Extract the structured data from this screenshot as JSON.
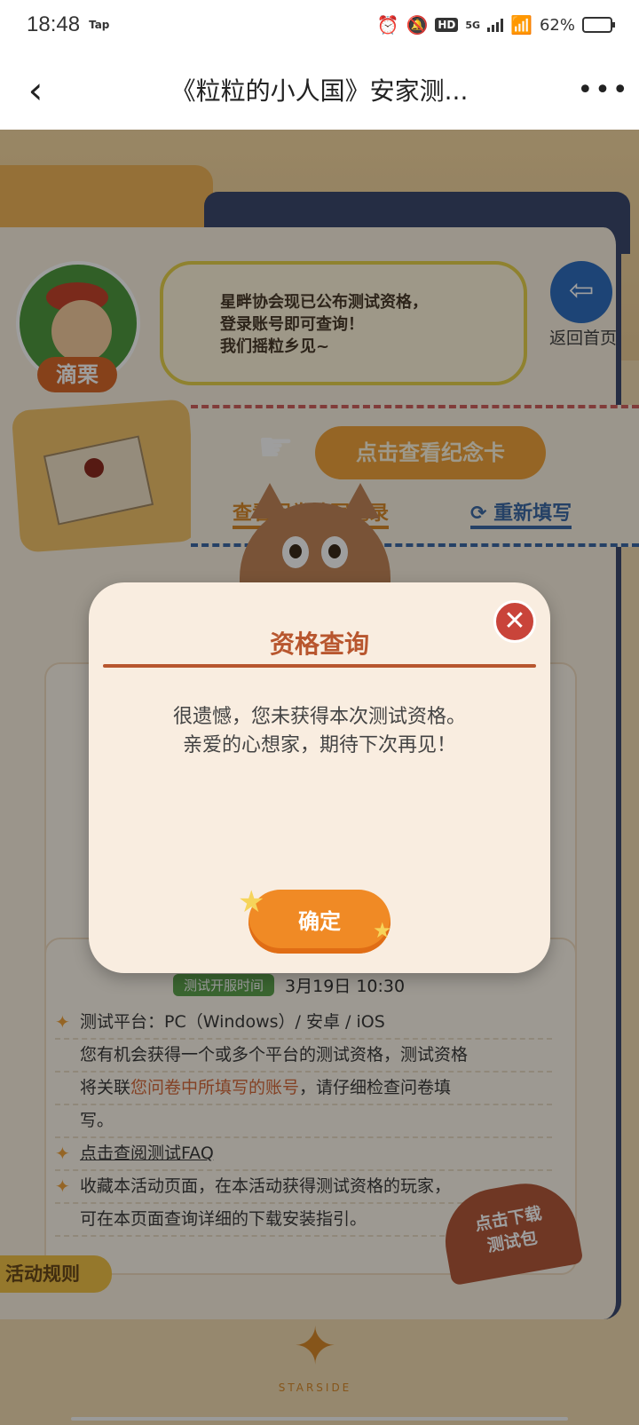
{
  "status_bar": {
    "time": "18:48",
    "tap_label": "Tap",
    "battery_text": "62%",
    "battery_level": 0.62,
    "network": "5G",
    "hd": "HD"
  },
  "nav": {
    "title": "《粒粒的小人国》安家测...",
    "back_icon": "chevron-left",
    "more_icon": "more-dots"
  },
  "page": {
    "avatar_name": "滴栗",
    "bubble_lines": [
      "星畔协会现已公布测试资格，",
      "登录账号即可查询！",
      "我们摇粒乡见~"
    ],
    "home_label": "返回首页",
    "memorial_button": "点击查看纪念卡",
    "record_link": "查看问卷填写记录",
    "refill_link": "重新填写",
    "server_time_tag": "测试开服时间",
    "server_time_value": "3月19日 10:30",
    "rules": {
      "platform": "测试平台：PC（Windows）/ 安卓 / iOS",
      "desc_1": "您有机会获得一个或多个平台的测试资格，测试资格",
      "desc_2a": "将关联",
      "desc_2_highlight": "您问卷中所填写的账号",
      "desc_2b": "，请仔细检查问卷填",
      "desc_3": "写。",
      "faq_link": "点击查阅测试FAQ",
      "bookmark_1": "收藏本活动页面，在本活动获得测试资格的玩家，",
      "bookmark_2": "可在本页面查询详细的下载安装指引。"
    },
    "download_tab": [
      "点击下载",
      "测试包"
    ],
    "rules_tab": "活动规则",
    "logo_text": "STARSIDE"
  },
  "modal": {
    "title": "资格查询",
    "line_1": "很遗憾，您未获得本次测试资格。",
    "line_2": "亲爱的心想家，期待下次再见！",
    "confirm_label": "确定",
    "close_icon": "close-x"
  },
  "colors": {
    "accent_orange": "#f08a25",
    "title_brown": "#b8562e",
    "close_red": "#c9443a",
    "home_blue": "#2f6fbf"
  }
}
